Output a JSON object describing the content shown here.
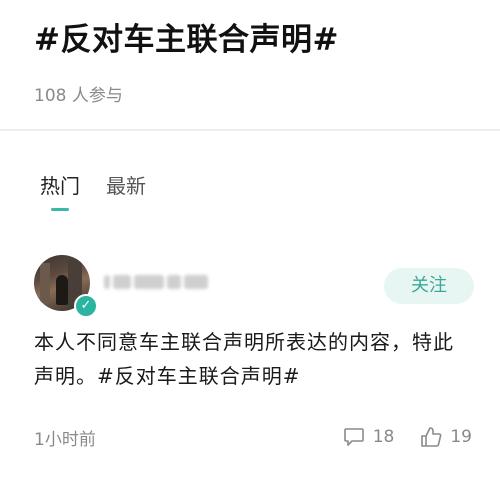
{
  "topic": {
    "title": "#反对车主联合声明#",
    "participants": "108 人参与"
  },
  "tabs": [
    {
      "label": "热门",
      "active": true
    },
    {
      "label": "最新",
      "active": false
    }
  ],
  "post": {
    "follow_label": "关注",
    "verified_icon": "check-icon",
    "content": "本人不同意车主联合声明所表达的内容，特此声明。#反对车主联合声明#",
    "time": "1小时前",
    "comments": "18",
    "likes": "19"
  },
  "colors": {
    "accent": "#39b8a8",
    "follow_bg": "#e8f6f3",
    "muted_text": "#8a8a8a"
  }
}
